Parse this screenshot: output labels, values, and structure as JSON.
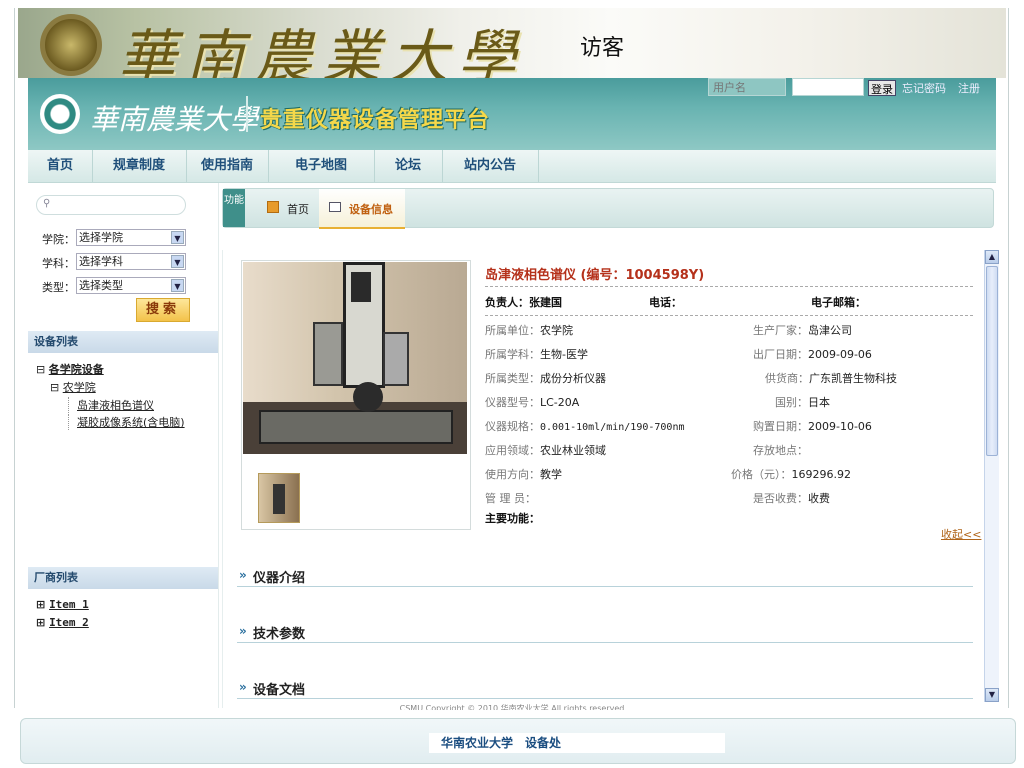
{
  "banner": {
    "calligraphy": "華南農業大學",
    "visitor_label": "访客"
  },
  "header": {
    "school_name": "華南農業大學",
    "platform_title": "贵重仪器设备管理平台",
    "username_placeholder": "用户名",
    "login_label": "登录",
    "forgot_label": "忘记密码",
    "register_label": "注册"
  },
  "nav": {
    "items": [
      "首页",
      "规章制度",
      "使用指南",
      "电子地图",
      "论坛",
      "站内公告"
    ]
  },
  "sidebar": {
    "filters": [
      {
        "label": "学院：",
        "value": "选择学院"
      },
      {
        "label": "学科：",
        "value": "选择学科"
      },
      {
        "label": "类型：",
        "value": "选择类型"
      }
    ],
    "search_button": "搜索",
    "device_list_title": "设备列表",
    "tree_root": "各学院设备",
    "tree_college": "农学院",
    "tree_devices": [
      "岛津液相色谱仪",
      "凝胶成像系统(含电脑)"
    ],
    "vendor_list_title": "厂商列表",
    "vendor_items": [
      "Item 1",
      "Item 2"
    ]
  },
  "crumb": {
    "func_label": "功能",
    "home": "首页",
    "current": "设备信息"
  },
  "device": {
    "title": "岛津液相色谱仪 (编号：1004598Y)",
    "owner_label": "负责人：张建国",
    "phone_label": "电话：",
    "email_label": "电子邮箱：",
    "left_fields": [
      {
        "k": "所属单位：",
        "v": "农学院"
      },
      {
        "k": "所属学科：",
        "v": "生物-医学"
      },
      {
        "k": "所属类型：",
        "v": "成份分析仪器"
      },
      {
        "k": "仪器型号：",
        "v": "LC-20A"
      },
      {
        "k": "仪器规格：",
        "v": "0.001-10ml/min/190-700nm"
      },
      {
        "k": "应用领域：",
        "v": "农业林业领域"
      },
      {
        "k": "使用方向：",
        "v": "教学"
      },
      {
        "k": "管 理 员：",
        "v": ""
      }
    ],
    "right_fields": [
      {
        "k": "生产厂家：",
        "v": "岛津公司"
      },
      {
        "k": "出厂日期：",
        "v": "2009-09-06"
      },
      {
        "k": "供货商：",
        "v": "广东凯普生物科技"
      },
      {
        "k": "国别：",
        "v": "日本"
      },
      {
        "k": "购置日期：",
        "v": "2009-10-06"
      },
      {
        "k": "存放地点：",
        "v": ""
      },
      {
        "k": "价格（元）：",
        "v": "169296.92"
      },
      {
        "k": "是否收费：",
        "v": "收费"
      }
    ],
    "main_function_label": "主要功能：",
    "collapse_label": "收起<<"
  },
  "sections": [
    "仪器介绍",
    "技术参数",
    "设备文档"
  ],
  "footer": {
    "copyright": "CSMU Copyright © 2010 华南农业大学 All rights reserved",
    "text": "华南农业大学　设备处"
  }
}
